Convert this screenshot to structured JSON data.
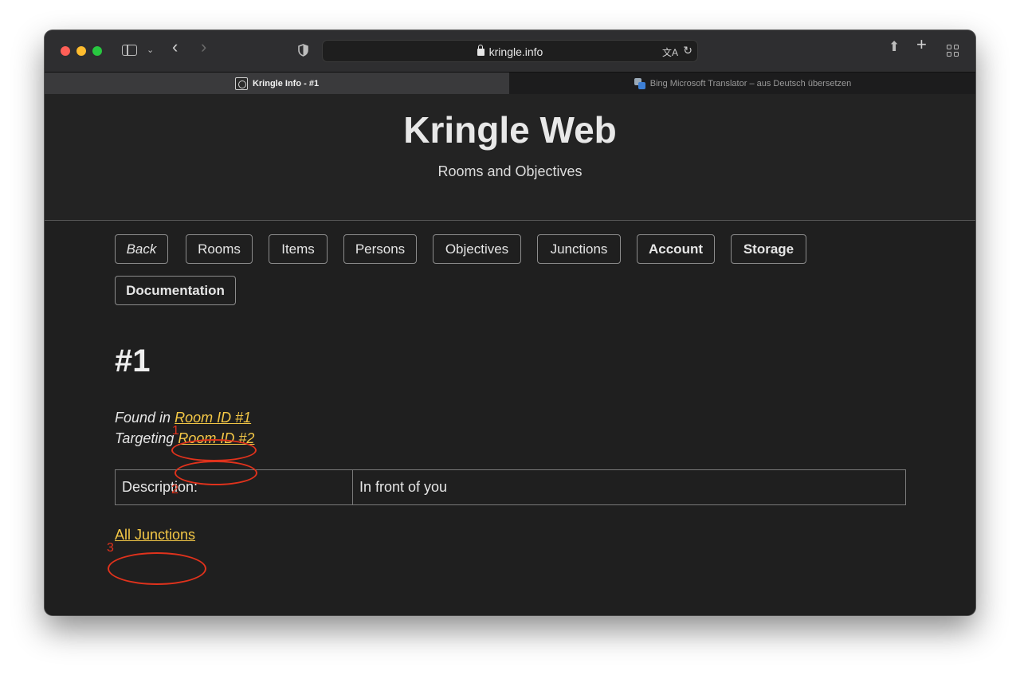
{
  "browser": {
    "url": "kringle.info",
    "tabs": [
      {
        "label": "Kringle Info - #1",
        "active": true
      },
      {
        "label": "Bing Microsoft Translator – aus Deutsch übersetzen",
        "active": false
      }
    ]
  },
  "header": {
    "title": "Kringle Web",
    "subtitle": "Rooms and Objectives"
  },
  "nav": {
    "buttons": [
      {
        "label": "Back",
        "style": "italic"
      },
      {
        "label": "Rooms",
        "style": "normal"
      },
      {
        "label": "Items",
        "style": "normal"
      },
      {
        "label": "Persons",
        "style": "normal"
      },
      {
        "label": "Objectives",
        "style": "normal"
      },
      {
        "label": "Junctions",
        "style": "normal"
      },
      {
        "label": "Account",
        "style": "bold"
      },
      {
        "label": "Storage",
        "style": "bold"
      },
      {
        "label": "Documentation",
        "style": "bold"
      }
    ]
  },
  "content": {
    "title": "#1",
    "found_prefix": "Found in",
    "found_link": "Room ID #1",
    "targeting_prefix": "Targeting",
    "targeting_link": "Room ID #2",
    "table": {
      "label": "Description:",
      "value": "In front of you"
    },
    "all_junctions_link": "All Junctions"
  },
  "annotations": {
    "labels": [
      "1",
      "2",
      "3"
    ],
    "color": "#e0321c"
  },
  "colors": {
    "link": "#f3c746",
    "background": "#1f1f1f"
  }
}
